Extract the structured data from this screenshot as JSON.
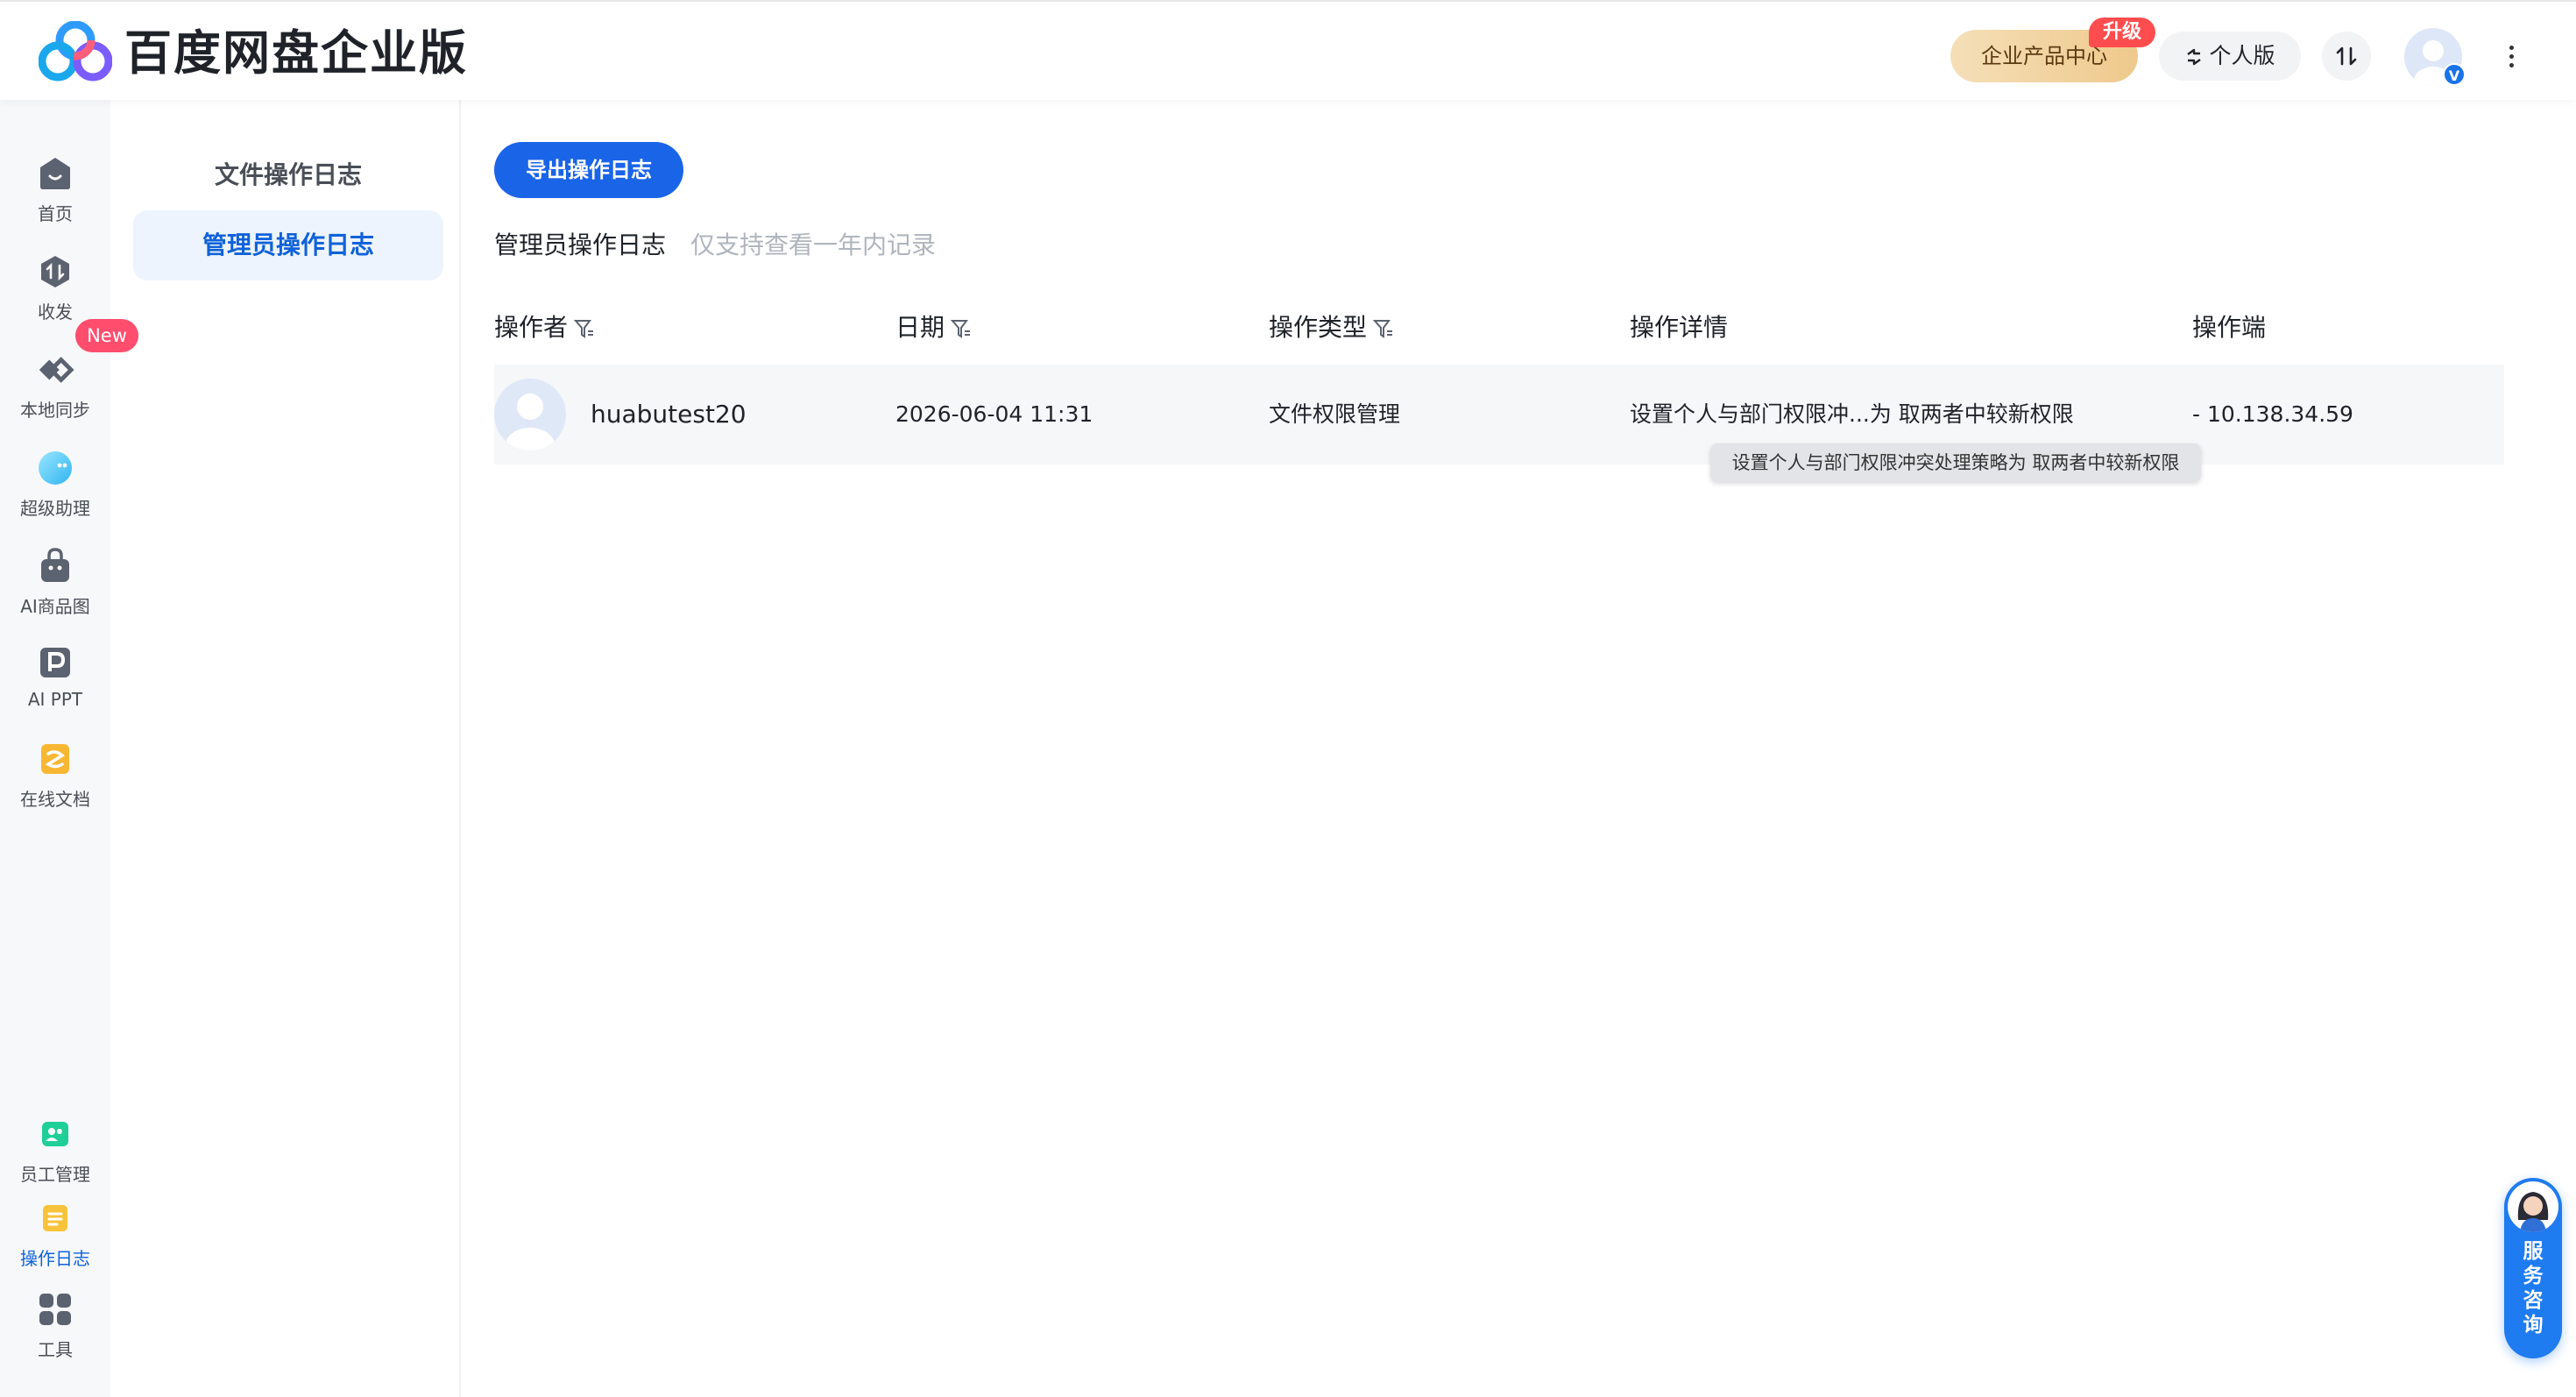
{
  "header": {
    "brand": "百度网盘企业版",
    "enterprise_center": "企业产品中心",
    "upgrade_badge": "升级",
    "personal_edition": "个人版",
    "vip_mark": "V"
  },
  "leftnav": {
    "items": [
      {
        "label": "首页",
        "icon": "home-icon"
      },
      {
        "label": "收发",
        "icon": "transfer-icon"
      },
      {
        "label": "本地同步",
        "icon": "sync-icon"
      },
      {
        "label": "超级助理",
        "icon": "assistant-icon"
      },
      {
        "label": "AI商品图",
        "icon": "shopping-bag-icon"
      },
      {
        "label": "AI PPT",
        "icon": "ppt-icon"
      },
      {
        "label": "在线文档",
        "icon": "document-icon"
      },
      {
        "label": "员工管理",
        "icon": "staff-icon"
      },
      {
        "label": "操作日志",
        "icon": "log-icon"
      },
      {
        "label": "工具",
        "icon": "grid-icon"
      }
    ],
    "new_badge": "New",
    "active": "操作日志"
  },
  "submenu": {
    "items": [
      {
        "label": "文件操作日志"
      },
      {
        "label": "管理员操作日志"
      }
    ],
    "active": "管理员操作日志"
  },
  "main": {
    "export_button": "导出操作日志",
    "section_title": "管理员操作日志",
    "section_hint": "仅支持查看一年内记录",
    "columns": [
      "操作者",
      "日期",
      "操作类型",
      "操作详情",
      "操作端"
    ],
    "rows": [
      {
        "operator": "huabutest20",
        "date": "2026-06-04 11:31",
        "type": "文件权限管理",
        "detail": "设置个人与部门权限冲...为 取两者中较新权限",
        "endpoint": "- 10.138.34.59"
      }
    ],
    "tooltip": "设置个人与部门权限冲突处理策略为 取两者中较新权限"
  },
  "service": {
    "chars": [
      "服",
      "务",
      "咨",
      "询"
    ]
  },
  "colors": {
    "accent": "#1a64e8",
    "active_text": "#0f62d9",
    "new_badge": "#ff4d6d",
    "upgrade_badge": "#ff4d4f"
  }
}
